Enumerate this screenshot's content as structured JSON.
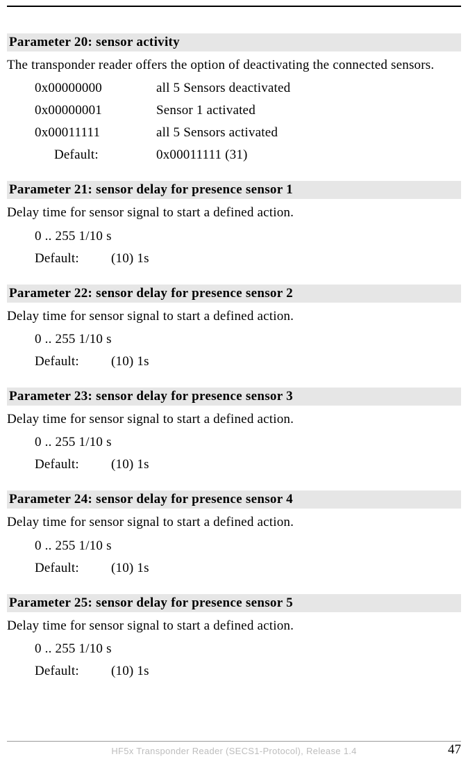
{
  "p20": {
    "title": "Parameter 20: sensor activity",
    "desc": "The transponder reader offers the option of deactivating the connected sensors.",
    "rows": [
      {
        "code": "0x00000000",
        "text": "all 5 Sensors deactivated"
      },
      {
        "code": "0x00000001",
        "text": "Sensor 1 activated"
      },
      {
        "code": "0x00011111",
        "text": "all 5 Sensors activated"
      }
    ],
    "default_label": "Default:",
    "default_value": "0x00011111 (31)"
  },
  "p21": {
    "title": "Parameter 21: sensor delay for presence sensor  1",
    "desc": "Delay time for sensor signal to start a defined action.",
    "range": "0 .. 255 1/10 s",
    "default_label": "Default:",
    "default_value": "(10) 1s"
  },
  "p22": {
    "title": "Parameter 22: sensor delay for presence sensor 2",
    "desc": "Delay time for sensor signal to start a defined action.",
    "range": "0 .. 255 1/10 s",
    "default_label": "Default:",
    "default_value": "(10) 1s"
  },
  "p23": {
    "title": "Parameter 23: sensor delay for presence sensor  3",
    "desc": "Delay time for sensor signal to start a defined action.",
    "range": "0 .. 255 1/10 s",
    "default_label": "Default:",
    "default_value": "(10) 1s"
  },
  "p24": {
    "title": "Parameter 24: sensor delay for presence sensor  4",
    "desc": "Delay time for sensor signal to start a defined action.",
    "range": "0 .. 255 1/10 s",
    "default_label": "Default:",
    "default_value": "(10) 1s"
  },
  "p25": {
    "title": "Parameter 25: sensor delay for presence sensor  5",
    "desc": "Delay time for sensor signal to start a defined action.",
    "range": "0 .. 255 1/10 s",
    "default_label": "Default:",
    "default_value": "(10) 1s"
  },
  "footer": {
    "center": "HF5x Transponder Reader (SECS1-Protocol), Release 1.4",
    "page": "47"
  }
}
